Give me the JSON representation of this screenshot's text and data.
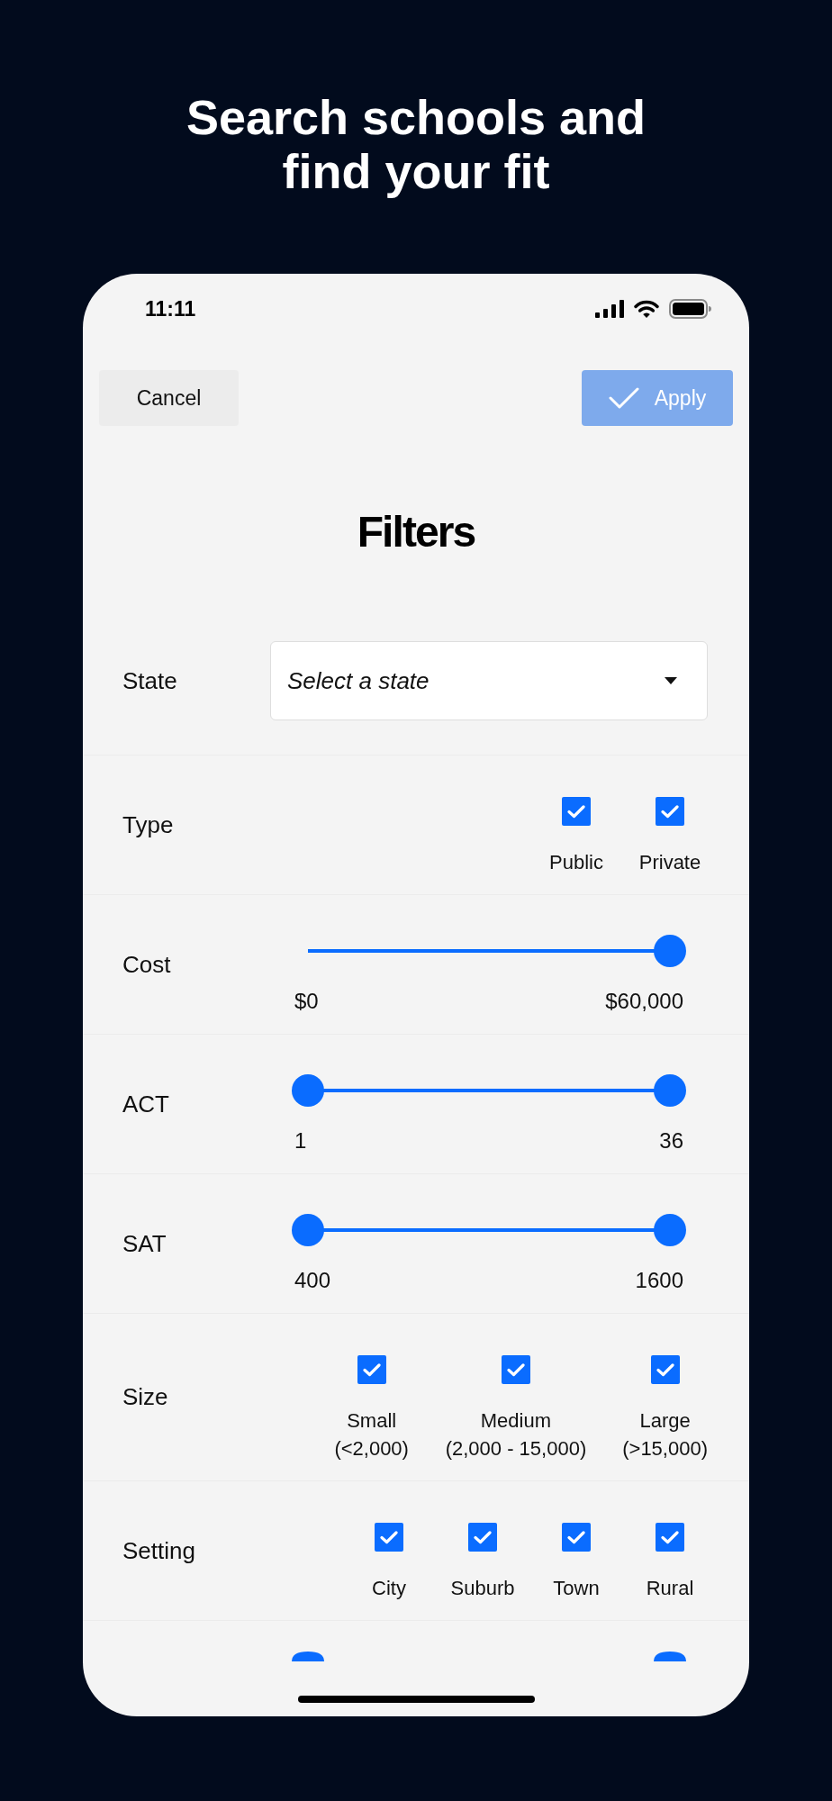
{
  "headline": "Search schools and find your fit",
  "status_bar": {
    "time": "11:11"
  },
  "toolbar": {
    "cancel": {
      "label": "Cancel"
    },
    "apply": {
      "label": "Apply",
      "disabled": true
    }
  },
  "title": "Filters",
  "filters": [
    {
      "kind": "dropdown",
      "label": "State",
      "placeholder": "Select a state"
    },
    {
      "kind": "checkboxes",
      "label": "Type",
      "options": [
        {
          "label": "Public",
          "checked": true
        },
        {
          "label": "Private",
          "checked": true
        }
      ]
    },
    {
      "kind": "slider",
      "label": "Cost",
      "thumbs": [
        {
          "level": 1
        }
      ],
      "min_label": "$0",
      "max_label": "$60,000"
    },
    {
      "kind": "slider",
      "label": "ACT",
      "thumbs": [
        {
          "level": 0
        },
        {
          "level": 1
        }
      ],
      "min_label": "1",
      "max_label": "36"
    },
    {
      "kind": "slider",
      "label": "SAT",
      "thumbs": [
        {
          "level": 0
        },
        {
          "level": 1
        }
      ],
      "min_label": "400",
      "max_label": "1600"
    },
    {
      "kind": "checkboxes",
      "label": "Size",
      "options": [
        {
          "label": "Small",
          "detail": "(<2,000)",
          "checked": true
        },
        {
          "label": "Medium",
          "detail": "(2,000 - 15,000)",
          "checked": true
        },
        {
          "label": "Large",
          "detail": "(>15,000)",
          "checked": true
        }
      ]
    },
    {
      "kind": "checkboxes",
      "label": "Setting",
      "options": [
        {
          "label": "City",
          "checked": true
        },
        {
          "label": "Suburb",
          "checked": true
        },
        {
          "label": "Town",
          "checked": true
        },
        {
          "label": "Rural",
          "checked": true
        }
      ]
    },
    {
      "kind": "slider",
      "thumbs": [
        {
          "level": 0
        },
        {
          "level": 1
        }
      ]
    }
  ]
}
